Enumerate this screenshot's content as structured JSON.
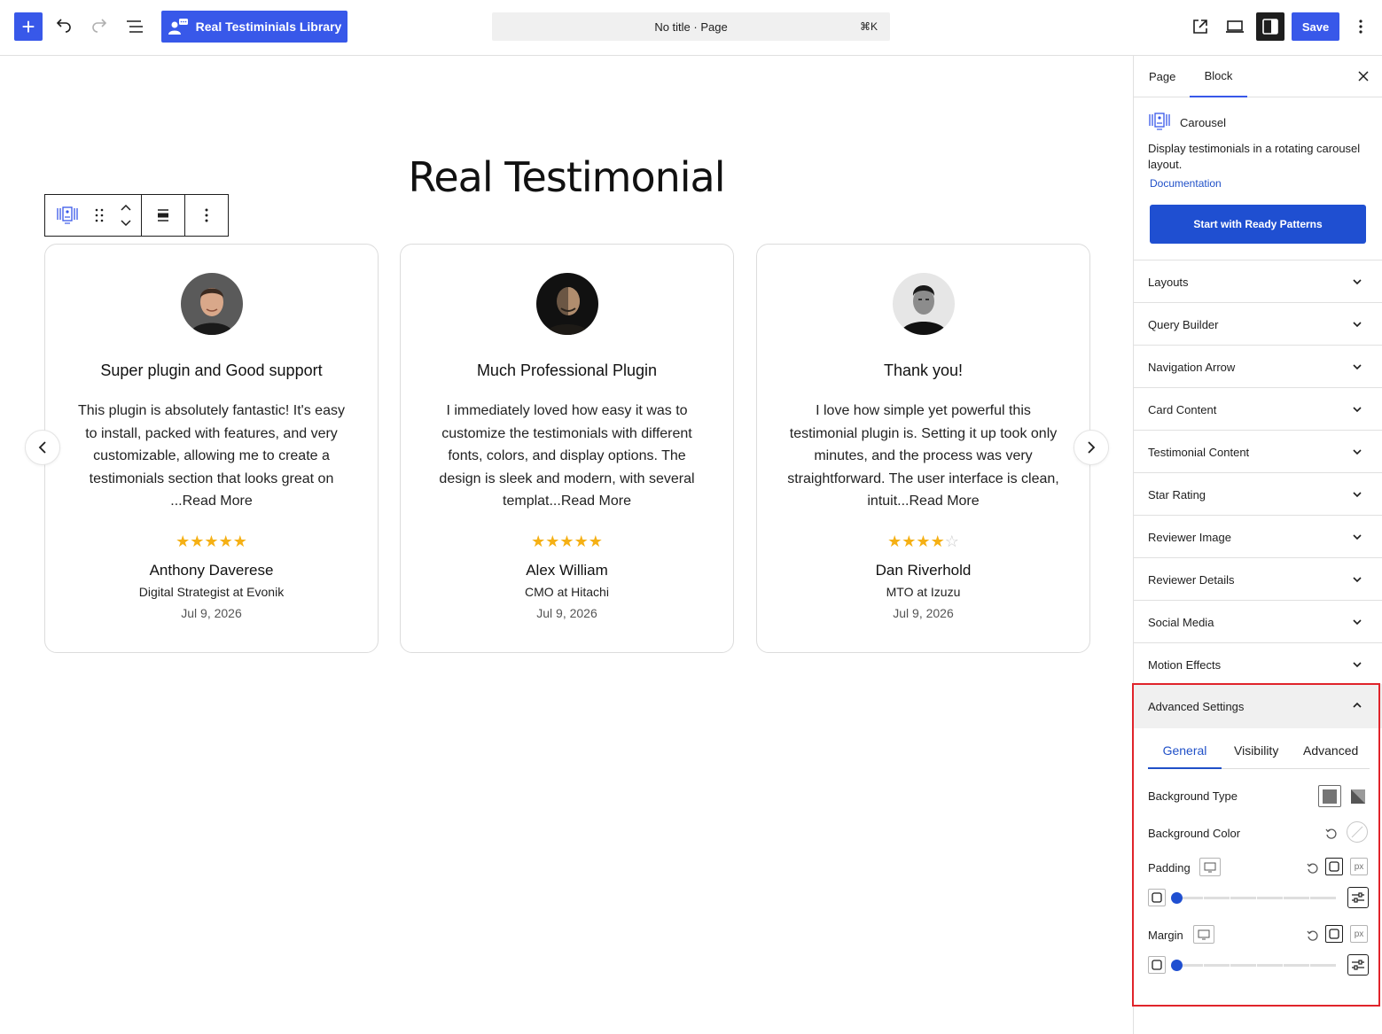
{
  "topbar": {
    "library_label": "Real Testiminials Library",
    "doc_title": "No title · Page",
    "shortcut": "⌘K",
    "save_label": "Save"
  },
  "canvas": {
    "heading": "Real Testimonial",
    "cards": [
      {
        "title": "Super plugin and Good support",
        "body": "This plugin is absolutely fantastic! It's easy to install, packed with features, and very customizable, allowing me to create a testimonials section that looks great on ...Read More",
        "rating": 5,
        "name": "Anthony Daverese",
        "role": "Digital Strategist at Evonik",
        "date": "Jul 9, 2026"
      },
      {
        "title": "Much Professional Plugin",
        "body": "I immediately loved how easy it was to customize the testimonials with different fonts, colors, and display options. The design is sleek and modern, with several templat...Read More",
        "rating": 5,
        "name": "Alex William",
        "role": "CMO at Hitachi",
        "date": "Jul 9, 2026"
      },
      {
        "title": "Thank you!",
        "body": "I love how simple yet powerful this testimonial plugin is. Setting it up took only minutes, and the process was very straightforward. The user interface is clean, intuit...Read More",
        "rating": 4,
        "name": "Dan Riverhold",
        "role": "MTO at Izuzu",
        "date": "Jul 9, 2026"
      }
    ],
    "star_color": "#f5b014"
  },
  "sidebar": {
    "tabs": {
      "page": "Page",
      "block": "Block"
    },
    "block": {
      "name": "Carousel",
      "description": "Display testimonials in a rotating carousel layout.",
      "doc_link": "Documentation",
      "patterns_button": "Start with Ready Patterns"
    },
    "panels": [
      "Layouts",
      "Query Builder",
      "Navigation Arrow",
      "Card Content",
      "Testimonial Content",
      "Star Rating",
      "Reviewer Image",
      "Reviewer Details",
      "Social Media",
      "Motion Effects"
    ],
    "advanced": {
      "title": "Advanced Settings",
      "tabs": {
        "general": "General",
        "visibility": "Visibility",
        "advanced": "Advanced"
      },
      "background_type": "Background Type",
      "background_color": "Background Color",
      "padding": "Padding",
      "margin": "Margin",
      "unit": "px",
      "padding_value": 0,
      "margin_value": 0
    }
  },
  "colors": {
    "accent": "#3858e9",
    "primary_button": "#1f4fd1",
    "highlight": "#e0242b"
  }
}
